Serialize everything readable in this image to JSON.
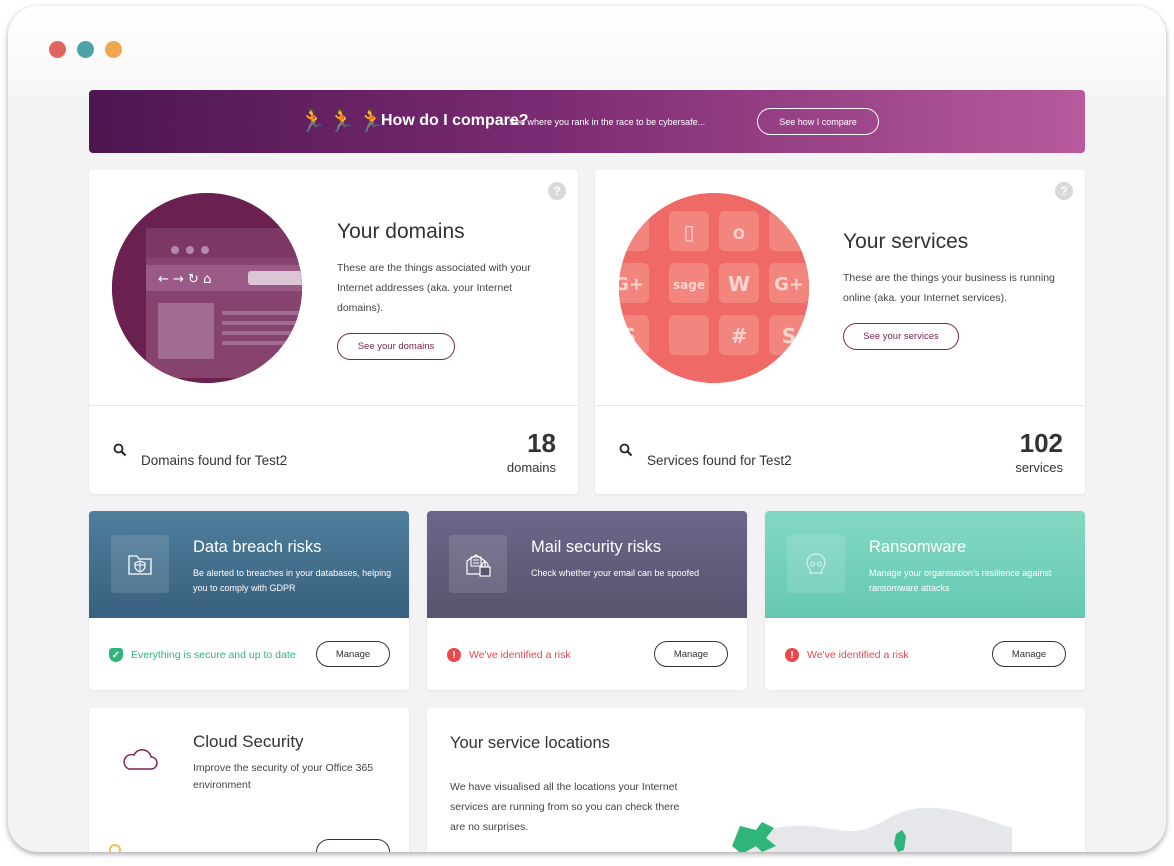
{
  "banner": {
    "runners": "🏃🏃🏃",
    "headline": "How do I compare?",
    "sub": "See where you rank in the race to be cybersafe...",
    "cta": "See how I compare"
  },
  "domains": {
    "title": "Your domains",
    "desc": "These are the things associated with your Internet addresses (aka. your Internet domains).",
    "button": "See your domains",
    "found": "Domains found for Test2",
    "count": "18",
    "unit": "domains"
  },
  "services": {
    "title": "Your services",
    "desc": "These are the things your business is running online (aka. your Internet services).",
    "button": "See your services",
    "found": "Services found for Test2",
    "count": "102",
    "unit": "services"
  },
  "help_label": "?",
  "risks": [
    {
      "title": "Data breach risks",
      "desc": "Be alerted to breaches in your databases, helping you to comply with GDPR",
      "status": "Everything is secure and up to date",
      "status_color": "#2fb57a",
      "button": "Manage"
    },
    {
      "title": "Mail security risks",
      "desc": "Check whether your email can be spoofed",
      "status": "We've identified a risk",
      "status_color": "#e9484d",
      "button": "Manage"
    },
    {
      "title": "Ransomware",
      "desc": "Manage your organisation's resilience against ransomware attacks",
      "status": "We've identified a risk",
      "status_color": "#e9484d",
      "button": "Manage"
    }
  ],
  "cloud": {
    "title": "Cloud Security",
    "desc": "Improve the security of your Office 365 environment"
  },
  "locations": {
    "title": "Your service locations",
    "desc": "We have visualised all the locations your Internet services are running from so you can check there are no surprises."
  },
  "colors": {
    "brand": "#7a2350",
    "breach_header": "#3e6f8f",
    "mail_header": "#5f5b7e",
    "ransomware_header": "#6fcfb7",
    "secure": "#2fb57a",
    "risk": "#e9484d"
  }
}
